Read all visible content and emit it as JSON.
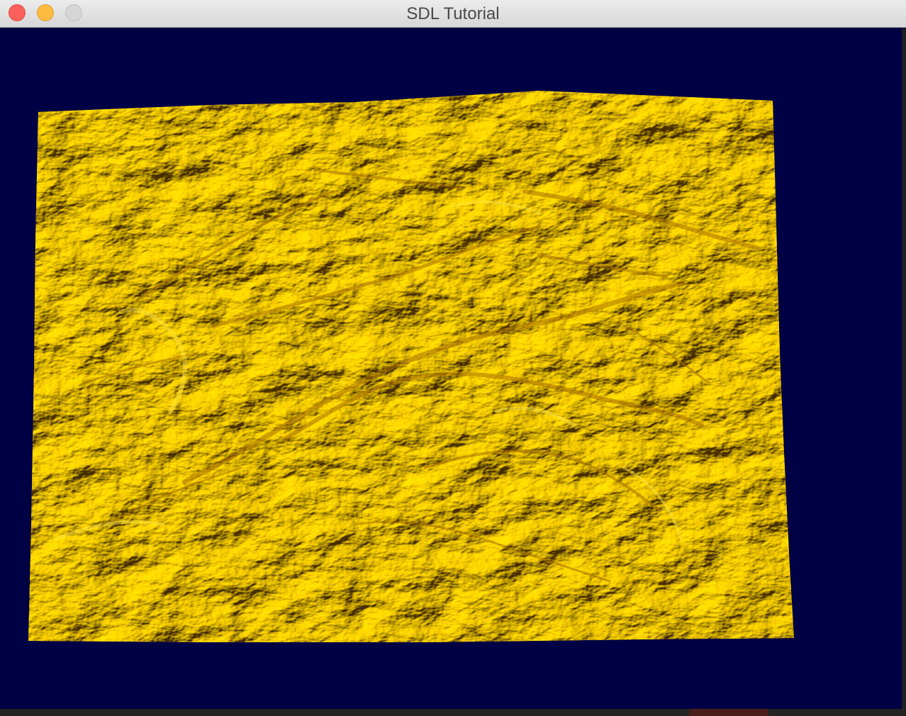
{
  "window": {
    "title": "SDL Tutorial",
    "controls": {
      "close": "close-icon",
      "minimize": "minimize-icon",
      "zoom": "zoom-icon"
    }
  },
  "viewport": {
    "background_color": "#000044",
    "content": "terrain-heightmap",
    "terrain_colors": {
      "light": "#ffd21c",
      "mid": "#f4b400",
      "dark": "#b07800"
    }
  }
}
